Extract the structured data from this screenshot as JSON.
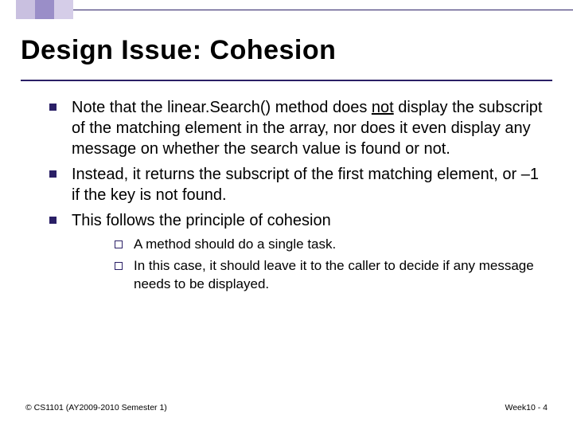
{
  "title": "Design Issue: Cohesion",
  "bullets": {
    "b1_pre": "Note that the linear.Search() method does ",
    "b1_not": "not",
    "b1_post": " display the subscript of the matching element in the array, nor does it even display any message on whether the search value is found or not.",
    "b2": "Instead, it returns the subscript of the first matching element, or –1 if the key is not found.",
    "b3": "This follows the principle of cohesion",
    "s1": "A method should do a single task.",
    "s2": "In this case, it should leave it to the caller to decide if any message needs to be displayed."
  },
  "footer": {
    "left": "© CS1101 (AY2009-2010 Semester 1)",
    "right": "Week10 - 4"
  }
}
